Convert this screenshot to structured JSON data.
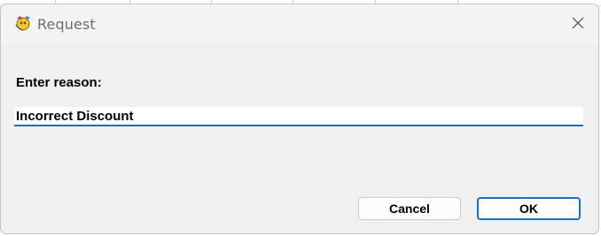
{
  "dialog": {
    "title": "Request",
    "app_icon": "app-logo-icon",
    "close_icon": "close-icon"
  },
  "form": {
    "prompt": "Enter reason:",
    "reason_value": "Incorrect Discount"
  },
  "buttons": {
    "cancel_label": "Cancel",
    "ok_label": "OK"
  },
  "colors": {
    "accent": "#1a6fc4",
    "dialog_bg": "#f0f0f0"
  }
}
